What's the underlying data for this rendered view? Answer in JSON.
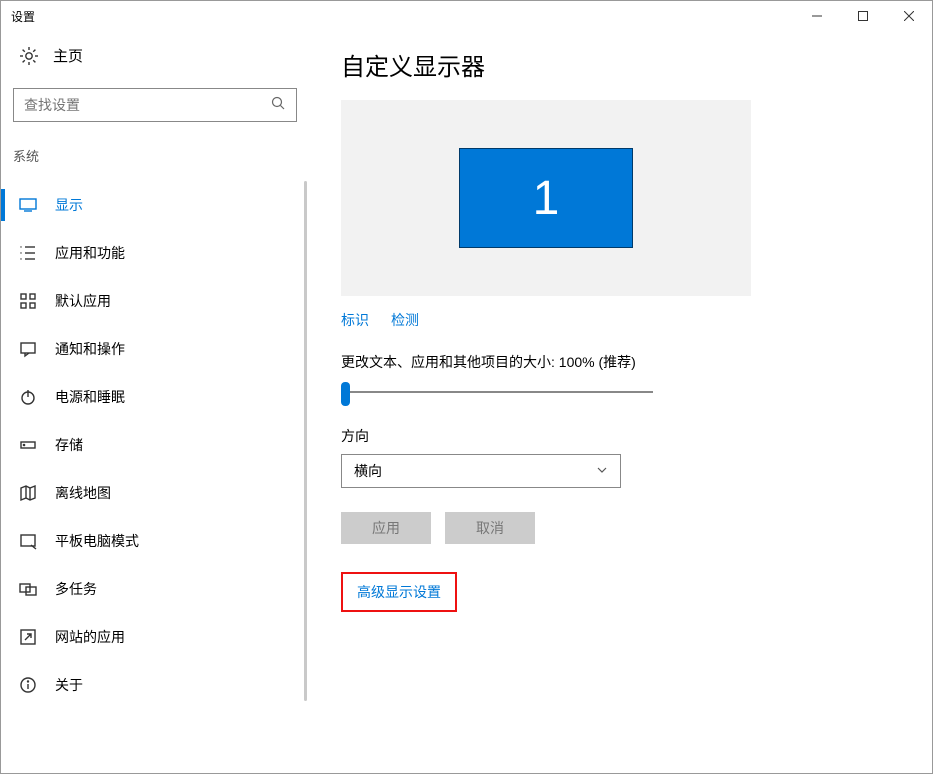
{
  "window": {
    "title": "设置"
  },
  "sidebar": {
    "home": "主页",
    "search_placeholder": "查找设置",
    "category": "系统",
    "items": [
      {
        "label": "显示"
      },
      {
        "label": "应用和功能"
      },
      {
        "label": "默认应用"
      },
      {
        "label": "通知和操作"
      },
      {
        "label": "电源和睡眠"
      },
      {
        "label": "存储"
      },
      {
        "label": "离线地图"
      },
      {
        "label": "平板电脑模式"
      },
      {
        "label": "多任务"
      },
      {
        "label": "网站的应用"
      },
      {
        "label": "关于"
      }
    ]
  },
  "main": {
    "heading": "自定义显示器",
    "monitor_number": "1",
    "identify": "标识",
    "detect": "检测",
    "scale_label": "更改文本、应用和其他项目的大小: 100% (推荐)",
    "orientation_label": "方向",
    "orientation_value": "横向",
    "apply": "应用",
    "cancel": "取消",
    "advanced": "高级显示设置"
  }
}
